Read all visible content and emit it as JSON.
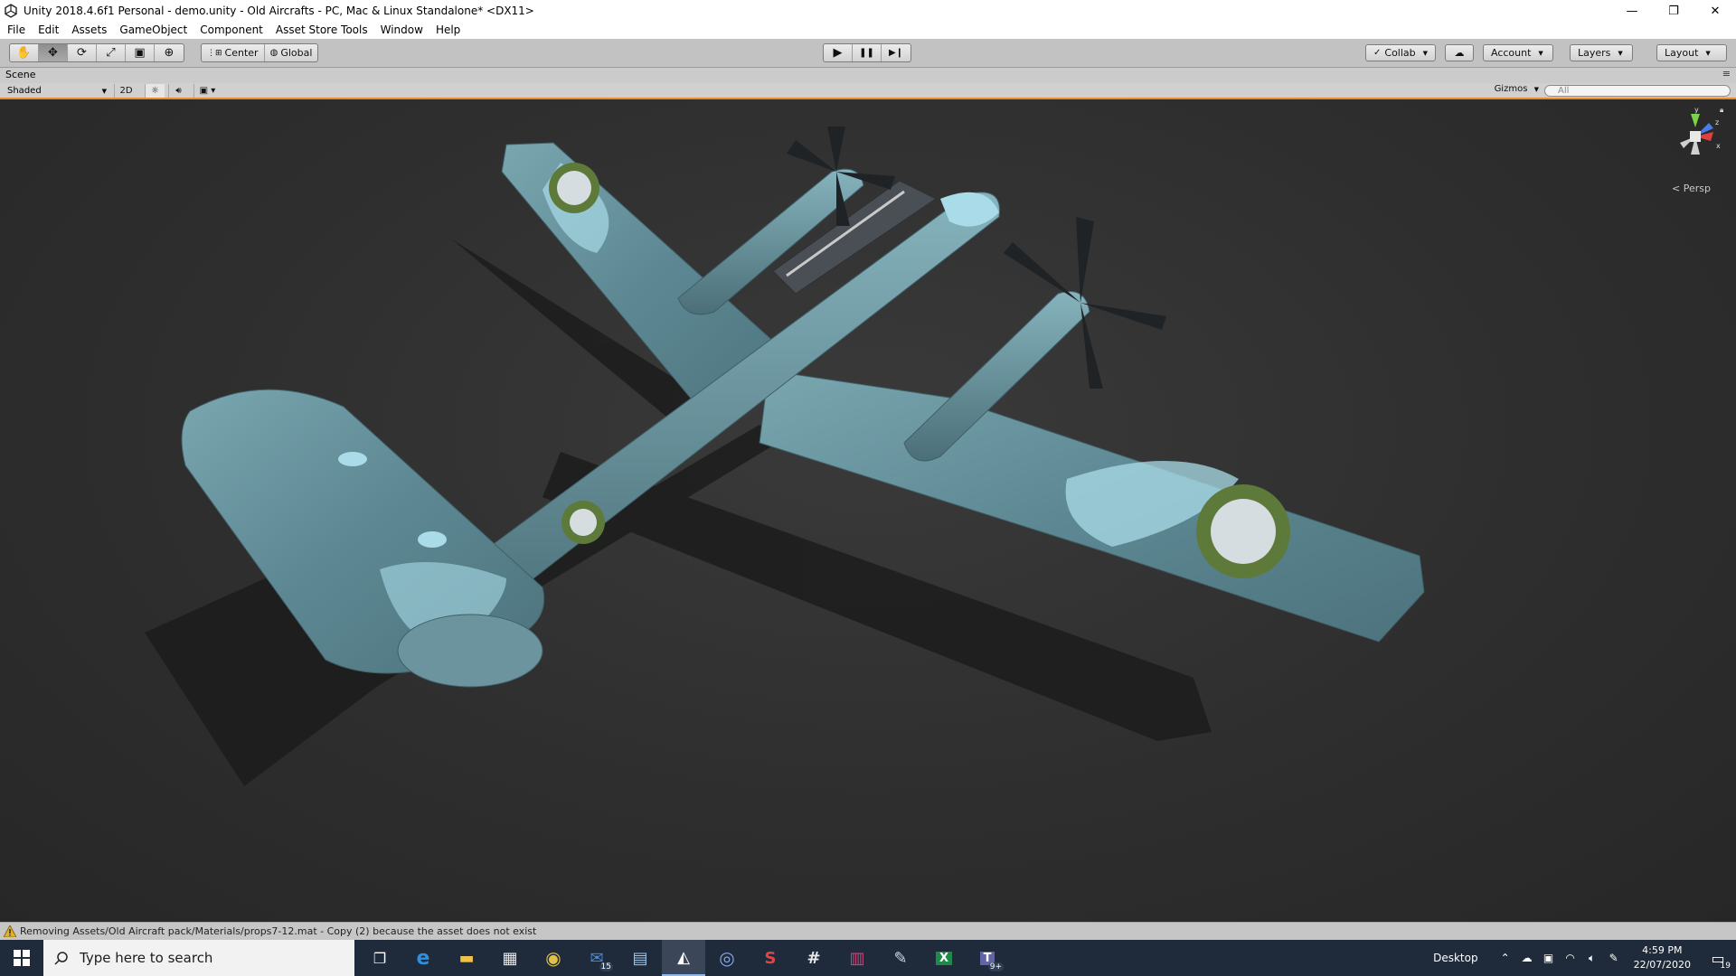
{
  "window": {
    "title": "Unity 2018.4.6f1 Personal - demo.unity - Old Aircrafts - PC, Mac & Linux Standalone* <DX11>",
    "minimize_glyph": "—",
    "restore_glyph": "❐",
    "close_glyph": "✕"
  },
  "menu": {
    "items": [
      "File",
      "Edit",
      "Assets",
      "GameObject",
      "Component",
      "Asset Store Tools",
      "Window",
      "Help"
    ]
  },
  "toolbar": {
    "tools": [
      {
        "name": "hand-tool",
        "glyph": "✋"
      },
      {
        "name": "move-tool",
        "glyph": "✥"
      },
      {
        "name": "rotate-tool",
        "glyph": "⟳"
      },
      {
        "name": "scale-tool",
        "glyph": "⤢"
      },
      {
        "name": "rect-tool",
        "glyph": "▣"
      },
      {
        "name": "transform-tool",
        "glyph": "⊕"
      }
    ],
    "pivot_label": "Center",
    "space_label": "Global",
    "play_glyph": "▶",
    "pause_glyph": "❚❚",
    "step_glyph": "▶❙",
    "collab_label": "Collab",
    "cloud_glyph": "☁",
    "account_label": "Account",
    "layers_label": "Layers",
    "layout_label": "Layout"
  },
  "scene": {
    "tab_label": "Scene",
    "shading_mode": "Shaded",
    "mode_2d": "2D",
    "gizmos_label": "Gizmos",
    "search_placeholder": "All",
    "projection_label": "Persp",
    "axis_x": "x",
    "axis_y": "y",
    "axis_z": "z"
  },
  "status": {
    "message": "Removing Assets/Old Aircraft pack/Materials/props7-12.mat - Copy (2) because the asset does not exist"
  },
  "taskbar": {
    "search_placeholder": "Type here to search",
    "apps": [
      {
        "name": "task-view",
        "glyph": "❐",
        "badge": ""
      },
      {
        "name": "edge",
        "glyph": "e",
        "badge": "",
        "color": "#2f8fe0"
      },
      {
        "name": "file-explorer",
        "glyph": "▬",
        "badge": "",
        "color": "#f0c24a"
      },
      {
        "name": "store",
        "glyph": "▦",
        "badge": "",
        "color": "#e8e8e8"
      },
      {
        "name": "chrome",
        "glyph": "◉",
        "badge": "",
        "color": "#e0c24a"
      },
      {
        "name": "mail",
        "glyph": "✉",
        "badge": "15",
        "color": "#4c8fd6"
      },
      {
        "name": "network-app",
        "glyph": "▤",
        "badge": "",
        "color": "#9ec6ea"
      },
      {
        "name": "unity",
        "glyph": "◭",
        "badge": "",
        "color": "#ffffff"
      },
      {
        "name": "cinema4d",
        "glyph": "◎",
        "badge": "",
        "color": "#8aa8e8"
      },
      {
        "name": "substance",
        "glyph": "S",
        "badge": "",
        "color": "#e04444"
      },
      {
        "name": "slack",
        "glyph": "#",
        "badge": "",
        "color": "#e8e8e8"
      },
      {
        "name": "winrar",
        "glyph": "▥",
        "badge": "",
        "color": "#c84c7a"
      },
      {
        "name": "paint",
        "glyph": "✎",
        "badge": "",
        "color": "#cfd8e8"
      },
      {
        "name": "excel",
        "glyph": "X",
        "badge": "",
        "color": "#1e8a4a"
      },
      {
        "name": "teams",
        "glyph": "T",
        "badge": "9+",
        "color": "#6264a7"
      }
    ],
    "desktop_label": "Desktop",
    "time": "4:59 PM",
    "date": "22/07/2020",
    "notification_count": "19"
  },
  "colors": {
    "accent_orange": "#e88a2c",
    "aircraft_base": "#5f8892",
    "aircraft_light": "#a9dce8",
    "roundel_ring": "#5d7a3a",
    "roundel_center": "#d6dde0"
  }
}
